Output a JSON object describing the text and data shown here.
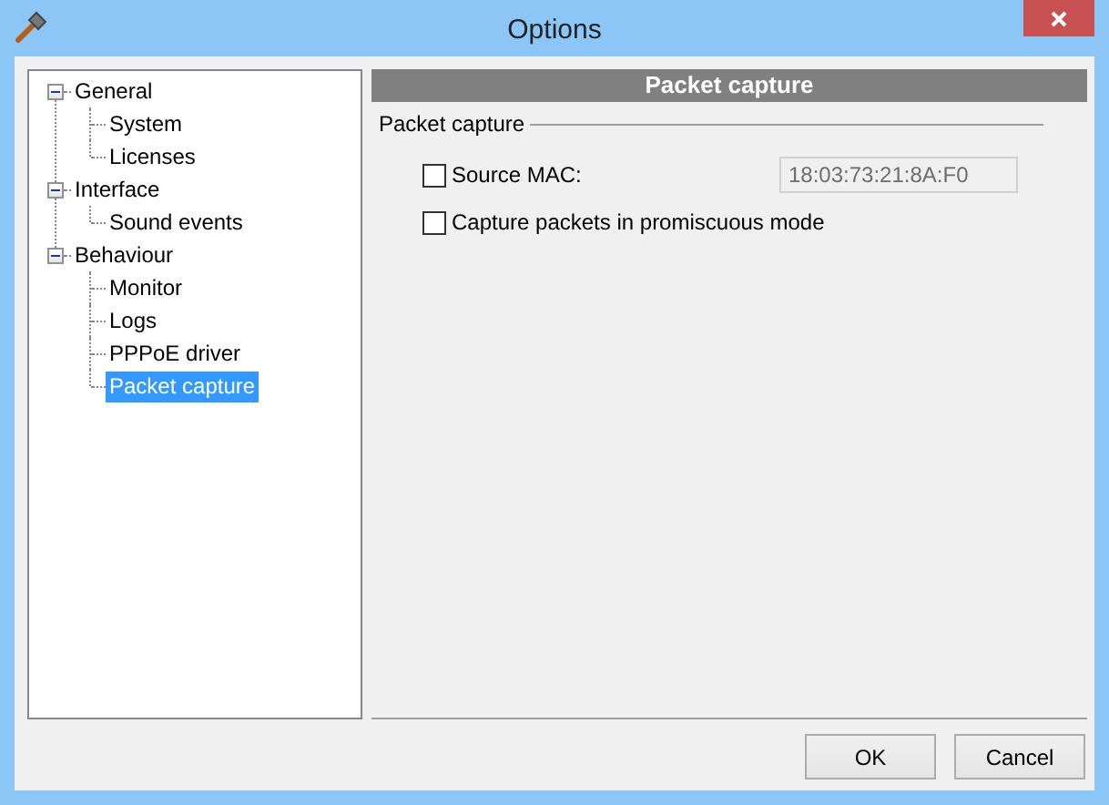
{
  "window": {
    "title": "Options"
  },
  "tree": [
    {
      "label": "General",
      "expanded": true,
      "selected": false,
      "children": [
        {
          "label": "System",
          "selected": false
        },
        {
          "label": "Licenses",
          "selected": false
        }
      ]
    },
    {
      "label": "Interface",
      "expanded": true,
      "selected": false,
      "children": [
        {
          "label": "Sound events",
          "selected": false
        }
      ]
    },
    {
      "label": "Behaviour",
      "expanded": true,
      "selected": false,
      "children": [
        {
          "label": "Monitor",
          "selected": false
        },
        {
          "label": "Logs",
          "selected": false
        },
        {
          "label": "PPPoE driver",
          "selected": false
        },
        {
          "label": "Packet capture",
          "selected": true
        }
      ]
    }
  ],
  "page": {
    "header": "Packet capture",
    "group": {
      "label": "Packet capture",
      "options": [
        {
          "kind": "checkbox_field",
          "label": "Source MAC:",
          "checked": false,
          "field": {
            "value": "18:03:73:21:8A:F0",
            "disabled": true
          }
        },
        {
          "kind": "checkbox",
          "label": "Capture packets in promiscuous mode",
          "checked": false
        }
      ]
    }
  },
  "buttons": [
    {
      "label": "OK"
    },
    {
      "label": "Cancel"
    }
  ]
}
